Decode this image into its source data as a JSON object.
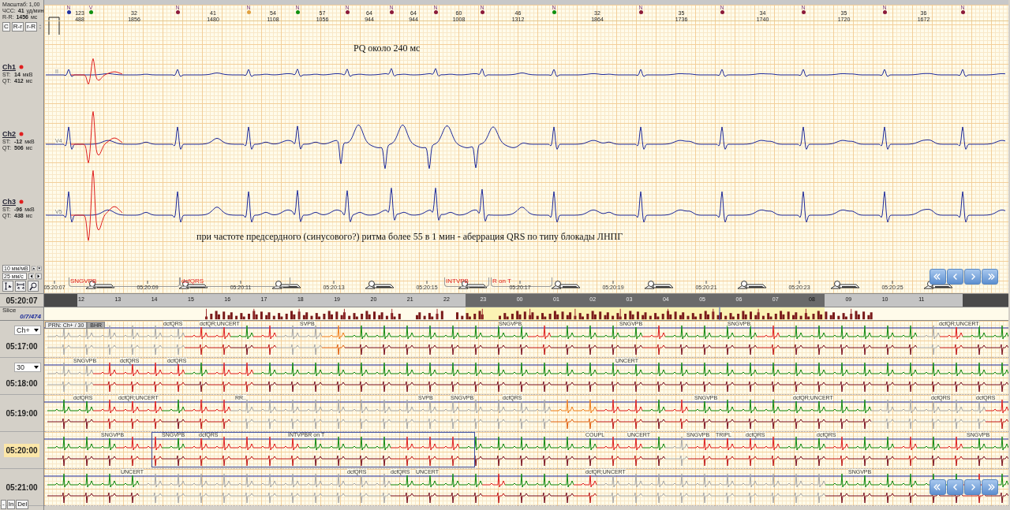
{
  "left_panel": {
    "scale": "Масштаб: 1,00",
    "hr": {
      "label": "ЧСС:",
      "value": "41",
      "unit": "уд/мин"
    },
    "rr": {
      "label": "R-R:",
      "value": "1456",
      "unit": "мс"
    },
    "buttons": [
      "C",
      "R-r",
      "r-R"
    ],
    "channels": [
      {
        "name": "Ch1",
        "st_label": "ST:",
        "st": "14",
        "st_unit": "мкВ",
        "qt_label": "QT:",
        "qt": "412",
        "qt_unit": "мс"
      },
      {
        "name": "Ch2",
        "st_label": "ST:",
        "st": "-12",
        "st_unit": "мкВ",
        "qt_label": "QT:",
        "qt": "506",
        "qt_unit": "мс"
      },
      {
        "name": "Ch3",
        "st_label": "ST:",
        "st": "-96",
        "st_unit": "мкВ",
        "qt_label": "QT:",
        "qt": "438",
        "qt_unit": "мс"
      }
    ],
    "gain": "10 мм/мВ",
    "speed": "25 мм/с"
  },
  "beats": [
    {
      "label": "N",
      "color": "#2030a0"
    },
    {
      "label": "V",
      "color": "#109010"
    },
    {
      "label": "N",
      "color": "#8b1a3a"
    },
    {
      "label": "N",
      "color": "#e0a040"
    },
    {
      "label": "N",
      "color": "#109010"
    },
    {
      "label": "N",
      "color": "#8b1a3a"
    },
    {
      "label": "N",
      "color": "#8b1a3a"
    },
    {
      "label": "N",
      "color": "#8b1a3a"
    },
    {
      "label": "N",
      "color": "#8b1a3a"
    },
    {
      "label": "N",
      "color": "#109010"
    },
    {
      "label": "N",
      "color": "#8b1a3a"
    },
    {
      "label": "N",
      "color": "#8b1a3a"
    },
    {
      "label": "N",
      "color": "#8b1a3a"
    },
    {
      "label": "N",
      "color": "#8b1a3a"
    },
    {
      "label": "N",
      "color": "#8b1a3a"
    }
  ],
  "intervals": [
    {
      "hr": "123",
      "rr": "488"
    },
    {
      "hr": "32",
      "rr": "1856"
    },
    {
      "hr": "41",
      "rr": "1480"
    },
    {
      "hr": "54",
      "rr": "1108"
    },
    {
      "hr": "57",
      "rr": "1056"
    },
    {
      "hr": "64",
      "rr": "944"
    },
    {
      "hr": "64",
      "rr": "944"
    },
    {
      "hr": "60",
      "rr": "1008"
    },
    {
      "hr": "46",
      "rr": "1312"
    },
    {
      "hr": "32",
      "rr": "1864"
    },
    {
      "hr": "35",
      "rr": "1736"
    },
    {
      "hr": "34",
      "rr": "1740"
    },
    {
      "hr": "35",
      "rr": "1720"
    },
    {
      "hr": "36",
      "rr": "1672"
    }
  ],
  "leads": [
    "II",
    "V4",
    "V5"
  ],
  "notes": [
    "PQ около 240 мс",
    "при частоте предсердного (синусового?) ритма более 55 в 1 мин - аберрация QRS по типу блокады ЛНПГ"
  ],
  "events": [
    "SNGVPB",
    "dcfQRS",
    "INTVPB",
    "R on T"
  ],
  "times": [
    "05:20:07",
    "05:20:09",
    "05:20:11",
    "05:20:13",
    "05:20:15",
    "05:20:17",
    "05:20:19",
    "05:20:21",
    "05:20:23",
    "05:20:25"
  ],
  "current_time": "05:20:07",
  "ruler": [
    "12",
    "13",
    "14",
    "15",
    "16",
    "17",
    "18",
    "19",
    "20",
    "21",
    "22",
    "23",
    "00",
    "01",
    "02",
    "03",
    "04",
    "05",
    "06",
    "07",
    "08",
    "09",
    "10",
    "11"
  ],
  "slice": {
    "label": "Slice",
    "value": "0/7/474"
  },
  "strips": {
    "channel": "Ch+",
    "minutes": "30",
    "tabs": [
      {
        "label": "PRN: Ch+ / 30",
        "selected": false
      },
      {
        "label": "BHR",
        "selected": true
      }
    ],
    "rows": [
      {
        "time": "05:17:00",
        "selected": false,
        "labels": [
          "dcfQRS",
          "dcfQR;UNCERT",
          "SVPB",
          "SNGVPB",
          "SNGVPB",
          "SNGVPB",
          "dcfQR;UNCERT"
        ]
      },
      {
        "time": "05:18:00",
        "selected": false,
        "labels": [
          "SNGVPB",
          "dcfQRS",
          "dcfQRS",
          "UNCERT"
        ]
      },
      {
        "time": "05:19:00",
        "selected": false,
        "labels": [
          "dcfQRS",
          "dcfQR;UNCERT",
          "RR..",
          "SVPB",
          "SNGVPB",
          "dcfQRS",
          "SNGVPB",
          "dcfQR;UNCERT",
          "dcfQRS",
          "dcfQRS"
        ]
      },
      {
        "time": "05:20:00",
        "selected": true,
        "labels": [
          "SNGVPB",
          "SNGVPB",
          "dcfQRS",
          "INTVPBR on T",
          "COUPL",
          "UNCERT",
          "SNGVPB",
          "TRIPL",
          "dcfQRS",
          "dcfQRS",
          "SNGVPB"
        ]
      },
      {
        "time": "05:21:00",
        "selected": false,
        "labels": [
          "UNCERT",
          "dcfQRS",
          "dcfQRS",
          "UNCERT",
          "dcfQR;UNCERT",
          "SNGVPB"
        ]
      }
    ],
    "buttons": [
      "-",
      "In",
      "Del"
    ]
  }
}
